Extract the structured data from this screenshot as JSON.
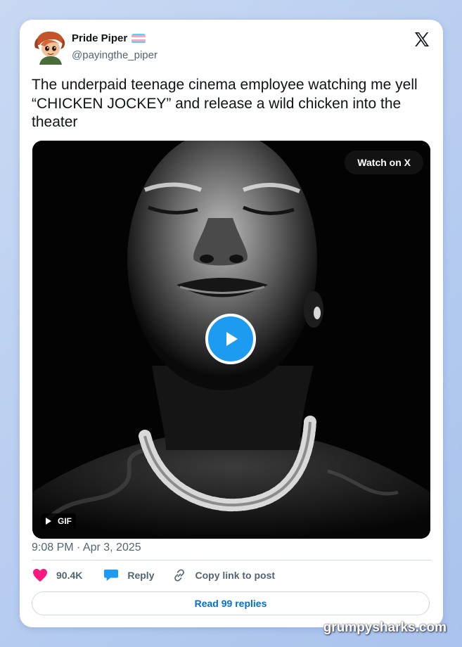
{
  "author": {
    "display_name": "Pride Piper",
    "handle": "@payingthe_piper"
  },
  "tweet": {
    "text": "The underpaid teenage cinema employee watching me yell “CHICKEN JOCKEY” and release a wild chicken into the theater",
    "timestamp": "9:08 PM · Apr 3, 2025"
  },
  "media": {
    "watch_label": "Watch on X",
    "gif_label": "GIF"
  },
  "actions": {
    "likes": "90.4K",
    "reply_label": "Reply",
    "copy_label": "Copy link to post"
  },
  "read_replies_label": "Read 99 replies",
  "watermark": "grumpysharks.com",
  "colors": {
    "accent": "#1d9bf0",
    "like": "#f91880",
    "link": "#006fd6",
    "flag_blue": "#5bcefa",
    "flag_pink": "#f5a9b8",
    "flag_white": "#ffffff"
  },
  "icons": [
    "x-logo-icon",
    "heart-icon",
    "reply-bubble-icon",
    "link-icon",
    "play-icon",
    "gif-play-icon"
  ]
}
